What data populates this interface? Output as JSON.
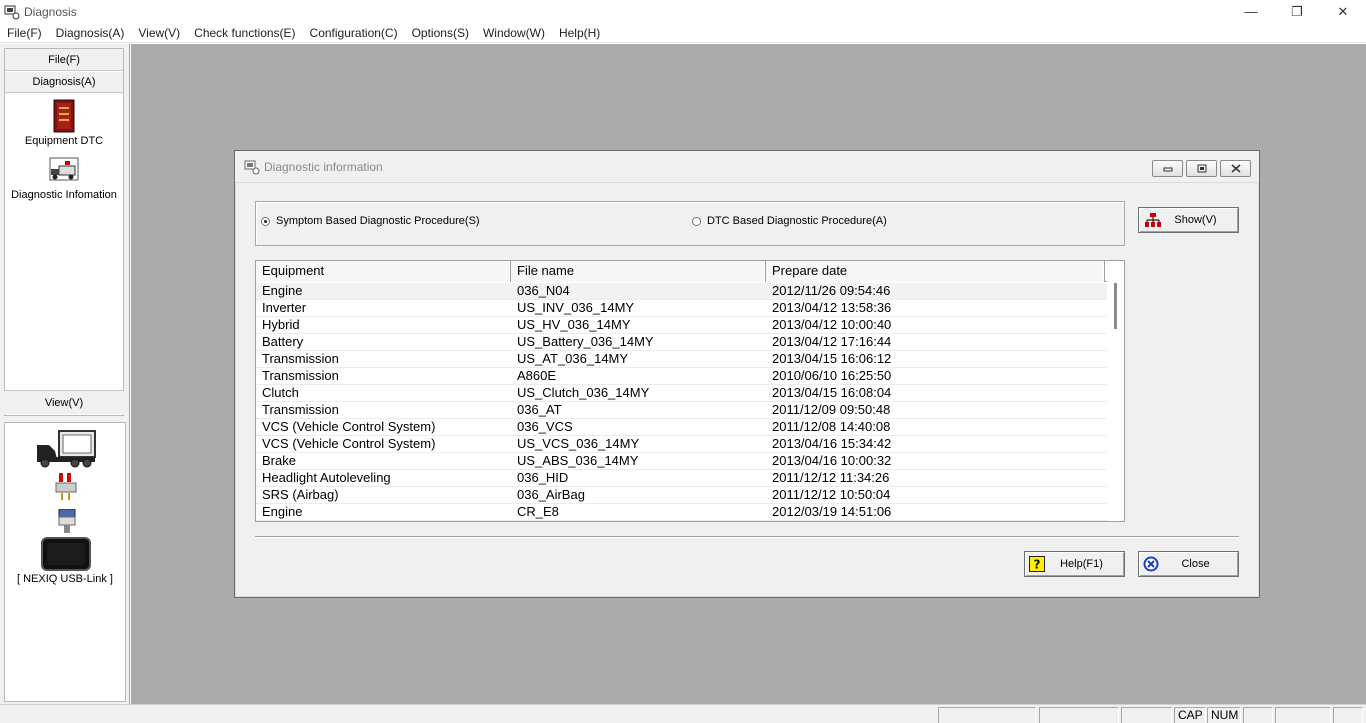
{
  "window": {
    "title": "Diagnosis",
    "minimize": "—",
    "restore": "❐",
    "close": "✕"
  },
  "menu": [
    "File(F)",
    "Diagnosis(A)",
    "View(V)",
    "Check functions(E)",
    "Configuration(C)",
    "Options(S)",
    "Window(W)",
    "Help(H)"
  ],
  "left_panel": {
    "file_label": "File(F)",
    "diagnosis_label": "Diagnosis(A)",
    "tools": [
      {
        "label": "Equipment DTC",
        "icon": "book-icon"
      },
      {
        "label": "Diagnostic Infomation",
        "icon": "truck-document-icon"
      }
    ],
    "view_label": "View(V)",
    "device_label": "[ NEXIQ USB-Link ]"
  },
  "dialog": {
    "title": "Diagnostic information",
    "radio_symptom": "Symptom Based Diagnostic Procedure(S)",
    "radio_dtc": "DTC Based Diagnostic Procedure(A)",
    "selected_radio": "symptom",
    "show_button": "Show(V)",
    "help_button": "Help(F1)",
    "close_button": "Close",
    "columns": [
      "Equipment",
      "File name",
      "Prepare date"
    ],
    "rows": [
      [
        "Engine",
        "036_N04",
        "2012/11/26 09:54:46"
      ],
      [
        "Inverter",
        "US_INV_036_14MY",
        "2013/04/12 13:58:36"
      ],
      [
        "Hybrid",
        "US_HV_036_14MY",
        "2013/04/12 10:00:40"
      ],
      [
        "Battery",
        "US_Battery_036_14MY",
        "2013/04/12 17:16:44"
      ],
      [
        "Transmission",
        "US_AT_036_14MY",
        "2013/04/15 16:06:12"
      ],
      [
        "Transmission",
        "A860E",
        "2010/06/10 16:25:50"
      ],
      [
        "Clutch",
        "US_Clutch_036_14MY",
        "2013/04/15 16:08:04"
      ],
      [
        "Transmission",
        "036_AT",
        "2011/12/09 09:50:48"
      ],
      [
        "VCS (Vehicle Control System)",
        "036_VCS",
        "2011/12/08 14:40:08"
      ],
      [
        "VCS (Vehicle Control System)",
        "US_VCS_036_14MY",
        "2013/04/16 15:34:42"
      ],
      [
        "Brake",
        "US_ABS_036_14MY",
        "2013/04/16 10:00:32"
      ],
      [
        "Headlight Autoleveling",
        "036_HID",
        "2011/12/12 11:34:26"
      ],
      [
        "SRS (Airbag)",
        "036_AirBag",
        "2011/12/12 10:50:04"
      ],
      [
        "Engine",
        "CR_E8",
        "2012/03/19 14:51:06"
      ]
    ]
  },
  "status": {
    "cap": "CAP",
    "num": "NUM"
  }
}
